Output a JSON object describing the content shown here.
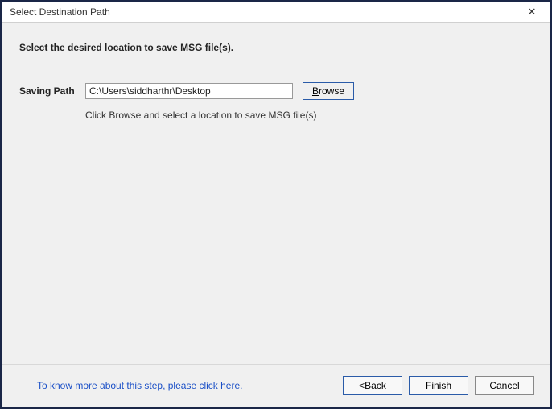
{
  "titlebar": {
    "title": "Select Destination Path",
    "close": "✕"
  },
  "content": {
    "heading": "Select the desired location to save MSG file(s).",
    "saving_label": "Saving Path",
    "path_value": "C:\\Users\\siddharthr\\Desktop",
    "browse_prefix": "B",
    "browse_rest": "rowse",
    "hint": "Click Browse and select a location to save MSG file(s)"
  },
  "footer": {
    "help_link": "To know more about this step, please click here.",
    "back_prefix": "< ",
    "back_u": "B",
    "back_rest": "ack",
    "finish": "Finish",
    "cancel": "Cancel"
  }
}
